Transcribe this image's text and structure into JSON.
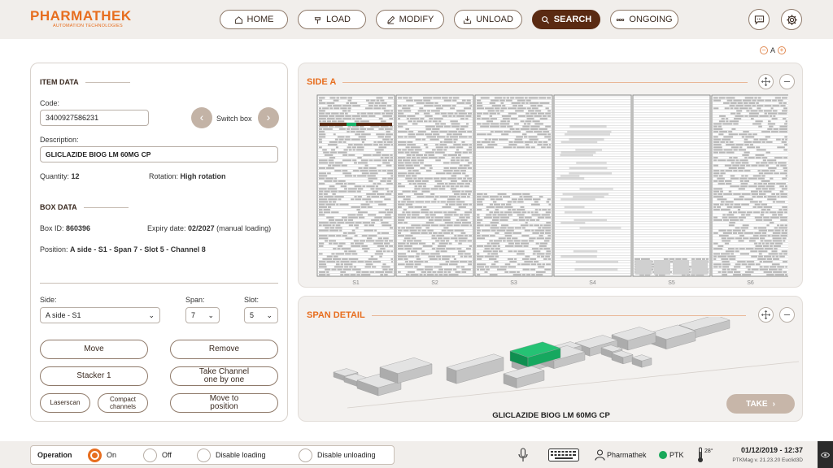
{
  "header": {
    "logo_main": "PHARMATHEK",
    "logo_sub": "AUTOMATION TECHNOLOGIES",
    "nav": {
      "home": "HOME",
      "load": "LOAD",
      "modify": "MODIFY",
      "unload": "UNLOAD",
      "search": "SEARCH",
      "ongoing": "ONGOING"
    }
  },
  "zoom": {
    "label": "A",
    "minus": "–",
    "plus": "+"
  },
  "item_data": {
    "title": "ITEM DATA",
    "code_label": "Code:",
    "code_value": "3400927586231",
    "switch_box": "Switch box",
    "description_label": "Description:",
    "description_value": "GLICLAZIDE BIOG LM 60MG CP",
    "quantity_label": "Quantity:",
    "quantity_value": "12",
    "rotation_label": "Rotation:",
    "rotation_value": "High rotation"
  },
  "box_data": {
    "title": "BOX DATA",
    "box_id_label": "Box ID:",
    "box_id_value": "860396",
    "expiry_label": "Expiry date:",
    "expiry_value": "02/2027",
    "expiry_note": "(manual loading)",
    "position_label": "Position:",
    "position_value": "A side - S1 - Span 7 - Slot 5 - Channel 8"
  },
  "selectors": {
    "side_label": "Side:",
    "side_value": "A side - S1",
    "span_label": "Span:",
    "span_value": "7",
    "slot_label": "Slot:",
    "slot_value": "5"
  },
  "actions": {
    "move": "Move",
    "remove": "Remove",
    "stacker": "Stacker 1",
    "take_channel_1": "Take Channel",
    "take_channel_2": "one by one",
    "laserscan": "Laserscan",
    "compact_1": "Compact",
    "compact_2": "channels",
    "move_to_1": "Move to",
    "move_to_2": "position"
  },
  "side_a": {
    "title": "SIDE A",
    "sections": [
      "S1",
      "S2",
      "S3",
      "S4",
      "S5",
      "S6"
    ]
  },
  "span_detail": {
    "title": "SPAN DETAIL",
    "take": "TAKE",
    "product": "GLICLAZIDE BIOG LM 60MG CP"
  },
  "status": {
    "operation": "Operation",
    "on": "On",
    "off": "Off",
    "disable_loading": "Disable loading",
    "disable_unloading": "Disable unloading",
    "user": "Pharmathek",
    "ptk": "PTK",
    "temperature": "28°",
    "datetime": "01/12/2019 - 12:37",
    "version": "PTKMag v. 21.23.20 Euclid3D"
  },
  "colors": {
    "accent": "#e76e1f",
    "nav_active": "#5a2a12",
    "highlight_box": "#1bb36a",
    "status_ok": "#18a85a"
  }
}
